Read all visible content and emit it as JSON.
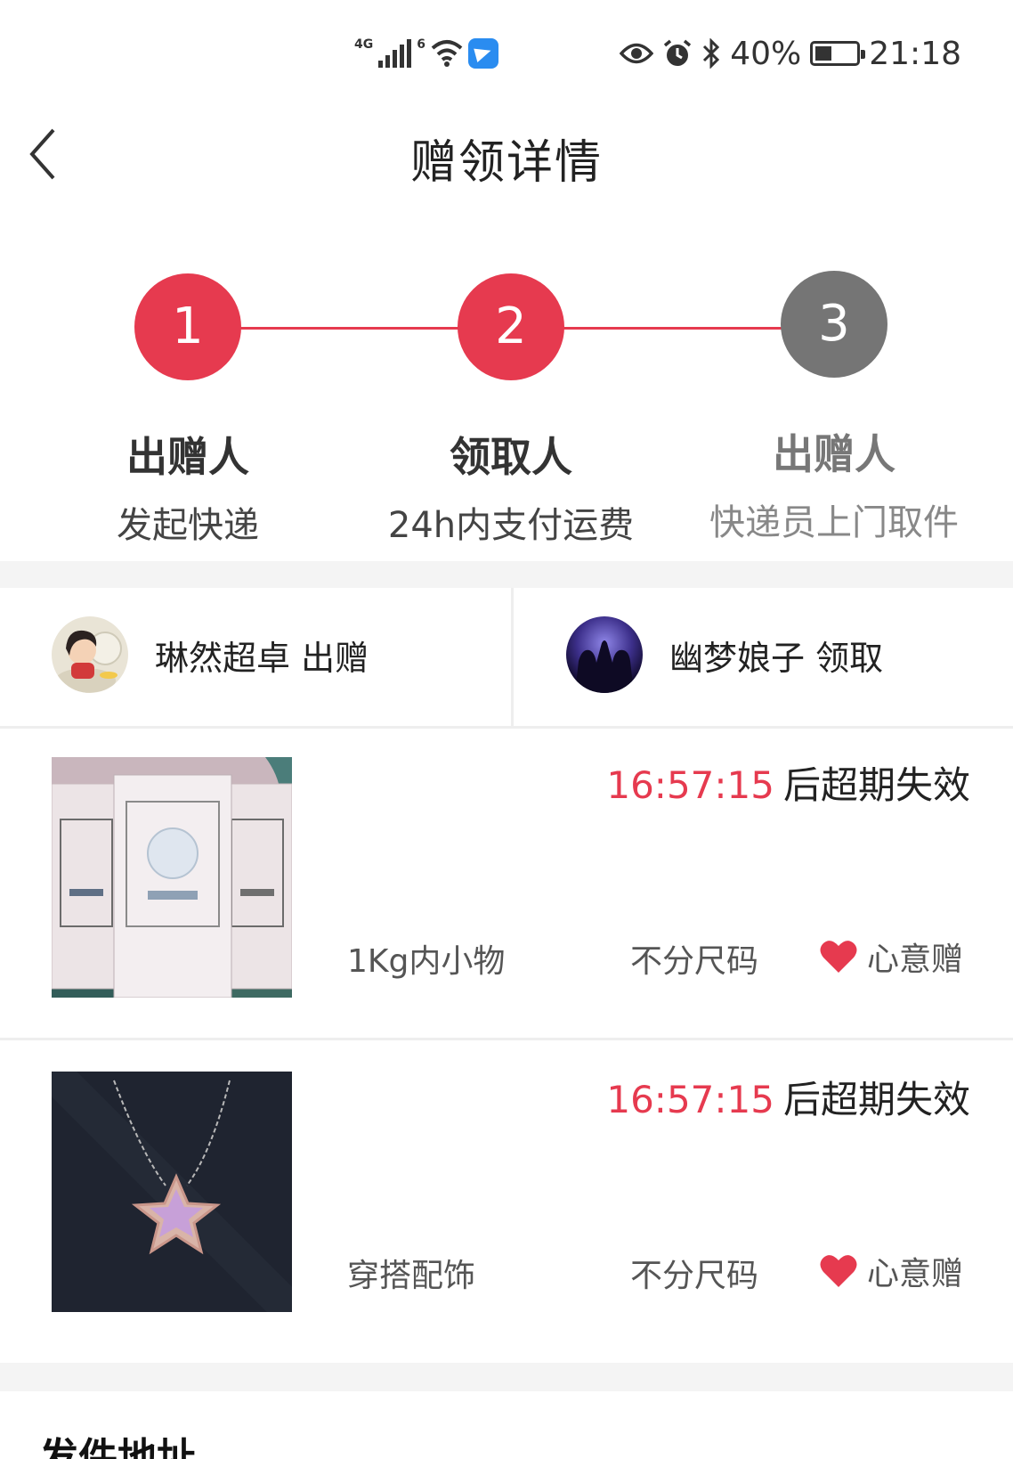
{
  "status_bar": {
    "network_left": "4G",
    "network_right": "6",
    "battery_percent": "40%",
    "time": "21:18",
    "battery_level": 0.4
  },
  "header": {
    "title": "赠领详情"
  },
  "steps": [
    {
      "number": "1",
      "role": "出赠人",
      "desc": "发起快递",
      "state": "done"
    },
    {
      "number": "2",
      "role": "领取人",
      "desc": "24h内支付运费",
      "state": "done"
    },
    {
      "number": "3",
      "role": "出赠人",
      "desc": "快递员上门取件",
      "state": "pending"
    }
  ],
  "users": {
    "giver": {
      "name": "琳然超卓 出赠"
    },
    "receiver": {
      "name": "幽梦娘子 领取"
    }
  },
  "items": [
    {
      "countdown_time": "16:57:15",
      "countdown_suffix": "后超期失效",
      "category": "1Kg内小物",
      "size": "不分尺码",
      "gift_type": "心意赠"
    },
    {
      "countdown_time": "16:57:15",
      "countdown_suffix": "后超期失效",
      "category": "穿搭配饰",
      "size": "不分尺码",
      "gift_type": "心意赠"
    }
  ],
  "address_section": {
    "title": "发件地址"
  },
  "colors": {
    "accent": "#e63a4f",
    "inactive_step": "#757575"
  }
}
